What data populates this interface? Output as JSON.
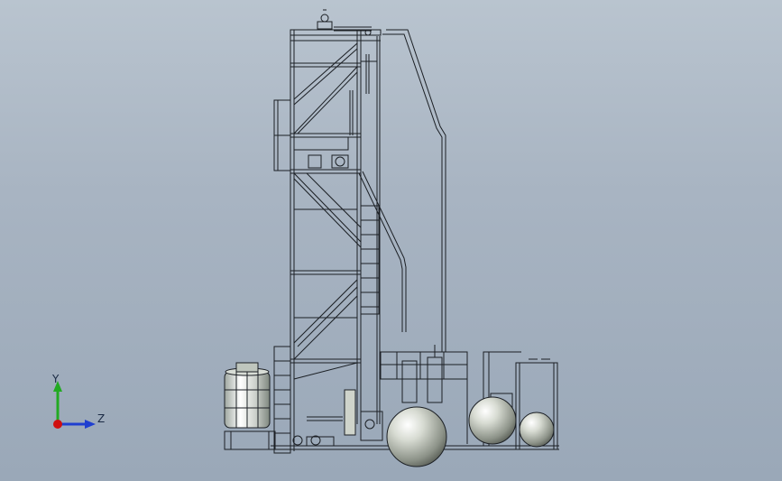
{
  "triad": {
    "y_label": "Y",
    "z_label": "Z",
    "colors": {
      "y": "#22aa22",
      "z": "#1f3fd0",
      "x": "#d01010"
    }
  },
  "scene": {
    "background_top": "#b9c4cf",
    "background_bottom": "#9aa8b8",
    "line_color": "#1b1f24",
    "sphere_color": "#c9cfc4"
  }
}
